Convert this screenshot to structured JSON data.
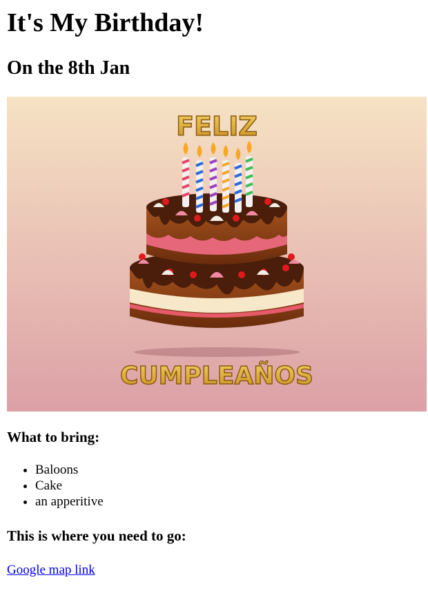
{
  "page": {
    "title": "It's My Birthday!",
    "date_heading": "On the 8th Jan"
  },
  "banner": {
    "top_text": "FELIZ",
    "bottom_text": "CUMPLEAÑOS",
    "background_top": "#f6e0c2",
    "background_bottom": "#dea0a5",
    "lettering_color": "#e3b33c",
    "candle_count": 6
  },
  "bring": {
    "heading": "What to bring:",
    "items": [
      "Baloons",
      "Cake",
      "an apperitive"
    ]
  },
  "directions": {
    "heading": "This is where you need to go:",
    "link_text": "Google map link"
  }
}
